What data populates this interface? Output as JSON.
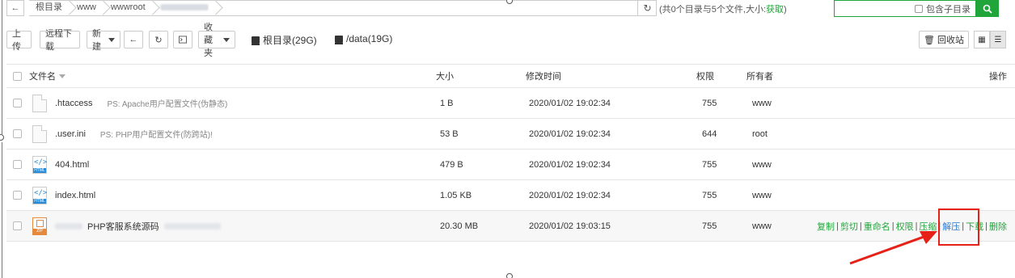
{
  "path": {
    "crumbs": [
      "根目录",
      "www",
      "wwwroot"
    ],
    "summary_prefix": "(共0个目录与5个文件,大小:",
    "summary_link": "获取",
    "summary_suffix": ")",
    "include_subdir_label": "包含子目录"
  },
  "toolbar": {
    "upload": "上传",
    "remote_download": "远程下载",
    "new": "新建",
    "favorites": "收藏夹",
    "disks": [
      "根目录(29G)",
      "/data(19G)"
    ],
    "recycle": "回收站"
  },
  "table": {
    "headers": {
      "name": "文件名",
      "size": "大小",
      "mtime": "修改时间",
      "perm": "权限",
      "owner": "所有者",
      "ops": "操作"
    },
    "rows": [
      {
        "icon": "blank",
        "name": ".htaccess",
        "desc": "PS: Apache用户配置文件(伪静态)",
        "size": "1 B",
        "mtime": "2020/01/02 19:02:34",
        "perm": "755",
        "owner": "www"
      },
      {
        "icon": "blank",
        "name": ".user.ini",
        "desc": "PS: PHP用户配置文件(防跨站)!",
        "size": "53 B",
        "mtime": "2020/01/02 19:02:34",
        "perm": "644",
        "owner": "root"
      },
      {
        "icon": "html",
        "name": "404.html",
        "desc": "",
        "size": "479 B",
        "mtime": "2020/01/02 19:02:34",
        "perm": "755",
        "owner": "www"
      },
      {
        "icon": "html",
        "name": "index.html",
        "desc": "",
        "size": "1.05 KB",
        "mtime": "2020/01/02 19:02:34",
        "perm": "755",
        "owner": "www"
      },
      {
        "icon": "zip",
        "name": "PHP客服系统源码",
        "desc": "",
        "size": "20.30 MB",
        "mtime": "2020/01/02 19:03:15",
        "perm": "755",
        "owner": "www"
      }
    ],
    "ops": [
      "复制",
      "剪切",
      "重命名",
      "权限",
      "压缩",
      "解压",
      "下载",
      "删除"
    ]
  },
  "icons": {
    "html_tag": "</>",
    "html_label": "HTML",
    "zip_label": "ZIP"
  },
  "colors": {
    "accent": "#20a53a",
    "highlight": "#e62117",
    "link_blue": "#2a7ad4"
  }
}
